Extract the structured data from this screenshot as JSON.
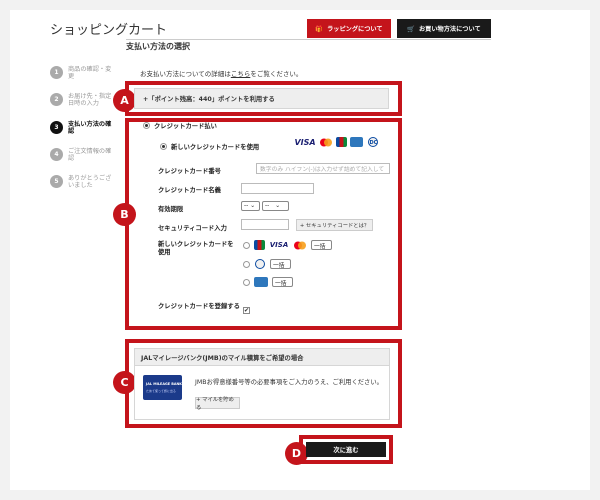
{
  "header": {
    "title": "ショッピングカート",
    "wrapping_button": "ラッピングについて",
    "howto_button": "お買い物方法について",
    "accent_color": "#c4141b"
  },
  "steps": [
    {
      "num": "1",
      "label": "商品の確認・変更"
    },
    {
      "num": "2",
      "label": "お届け先・指定日時の入力"
    },
    {
      "num": "3",
      "label": "支払い方法の確認"
    },
    {
      "num": "4",
      "label": "ご注文情報の確認"
    },
    {
      "num": "5",
      "label": "ありがとうございました"
    }
  ],
  "main": {
    "section_title": "支払い方法の選択",
    "note_before": "お支払い方法についての詳細は",
    "note_link": "こちら",
    "note_after": "をご覧ください。"
  },
  "markers": {
    "a": "A",
    "b": "B",
    "c": "C",
    "d": "D"
  },
  "points": {
    "label": "+「ポイント残高：440」ポイントを利用する"
  },
  "credit": {
    "option_label": "クレジットカード払い",
    "new_card_label": "新しいクレジットカードを使用",
    "card_brands": [
      "VISA",
      "MC",
      "JCB",
      "AMEX",
      "DC"
    ],
    "number_label": "クレジットカード番号",
    "number_placeholder": "数字のみ ハイフン(-)は入力せず詰めて記入して",
    "name_label": "クレジットカード名義",
    "expiry_label": "有効期限",
    "expiry_month": "--",
    "expiry_year": "--",
    "security_label": "セキュリティコード入力",
    "security_help": "+ セキュリティコードとは？",
    "use_new_label": "新しいクレジットカードを使用",
    "installment": "一括",
    "register_label": "クレジットカードを登録する",
    "register_check": "✔"
  },
  "jal": {
    "head": "JALマイレージバンク(JMB)のマイル積算をご希望の場合",
    "card_title": "JAL MILEAGE BANK",
    "card_sub": "ためて使って旅に出る",
    "desc": "JMBお得意様番号等の必要事項をご入力のうえ、ご利用ください。",
    "button": "+ マイルを貯める"
  },
  "next": {
    "label": "次に進む"
  }
}
